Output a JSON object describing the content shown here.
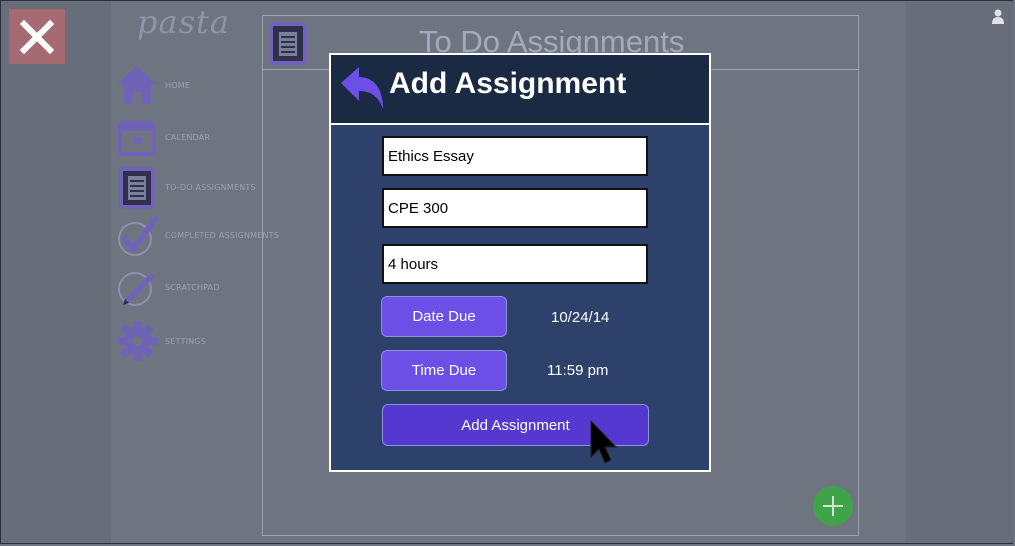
{
  "app": {
    "logo": "pasta"
  },
  "sidebar": {
    "items": [
      {
        "label": "HOME",
        "icon": "home-icon"
      },
      {
        "label": "CALENDAR",
        "icon": "calendar-icon"
      },
      {
        "label": "TO-DO ASSIGNMENTS",
        "icon": "clipboard-icon"
      },
      {
        "label": "COMPLETED ASSIGNMENTS",
        "icon": "checkmark-icon"
      },
      {
        "label": "SCRATCHPAD",
        "icon": "pencil-icon"
      },
      {
        "label": "SETTINGS",
        "icon": "gear-icon"
      }
    ]
  },
  "panel": {
    "title": "To Do Assignments"
  },
  "modal": {
    "title": "Add Assignment",
    "fields": {
      "name": "Ethics Essay",
      "course": "CPE 300",
      "duration": "4 hours"
    },
    "date_due_label": "Date Due",
    "date_due_value": "10/24/14",
    "time_due_label": "Time Due",
    "time_due_value": "11:59 pm",
    "submit_label": "Add Assignment"
  },
  "colors": {
    "modal_bg": "#2d416b",
    "modal_header": "#1a2a42",
    "accent_purple": "#6c4fe6",
    "close_red": "#a66a72",
    "fab_green": "#3fa34a"
  }
}
